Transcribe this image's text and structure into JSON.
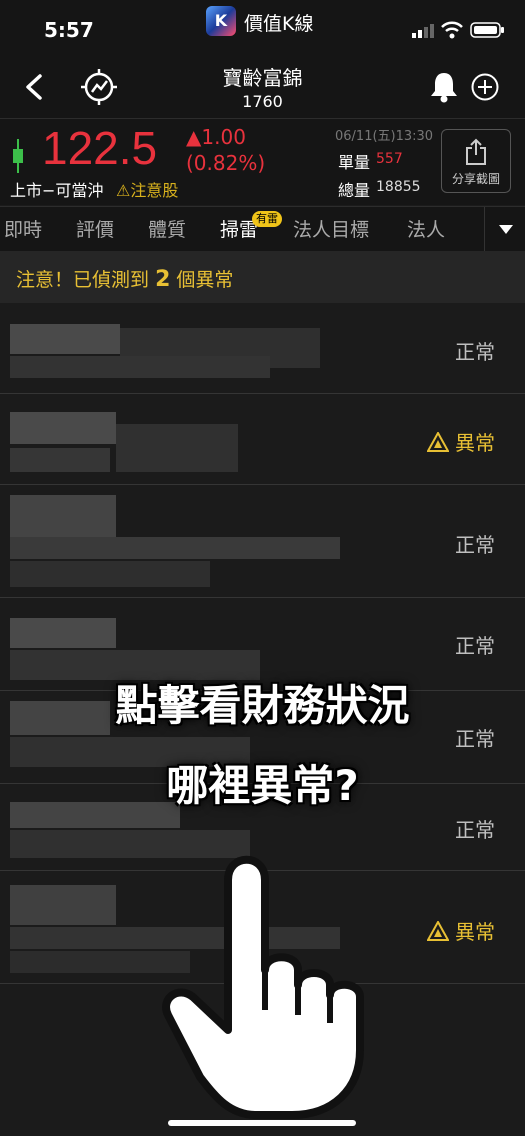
{
  "status_bar": {
    "time": "5:57",
    "app_name": "價值K線",
    "app_logo_letter": "K"
  },
  "header": {
    "stock_name": "寶齡富錦",
    "stock_code": "1760"
  },
  "price": {
    "value": "122.5",
    "change": "▲1.00",
    "change_pct": "(0.82%)",
    "market": "上市−可當沖",
    "warning": "⚠注意股",
    "datetime": "06/11(五)13:30",
    "unit_vol_label": "單量",
    "unit_vol": "557",
    "total_vol_label": "總量",
    "total_vol": "18855",
    "share_label": "分享截圖"
  },
  "tabs": [
    {
      "label": "即時"
    },
    {
      "label": "評價"
    },
    {
      "label": "體質"
    },
    {
      "label": "掃雷",
      "badge": "有雷",
      "active": true
    },
    {
      "label": "法人目標"
    },
    {
      "label": "法人"
    }
  ],
  "alert": {
    "prefix": "注意！已偵測到",
    "count": "2",
    "suffix": "個異常"
  },
  "rows": [
    {
      "status": "正常",
      "type": "normal"
    },
    {
      "status": "異常",
      "type": "abnormal"
    },
    {
      "status": "正常",
      "type": "normal"
    },
    {
      "status": "正常",
      "type": "normal"
    },
    {
      "status": "正常",
      "type": "normal"
    },
    {
      "status": "正常",
      "type": "normal"
    },
    {
      "status": "異常",
      "type": "abnormal"
    }
  ],
  "overlay": {
    "line1": "點擊看財務狀況",
    "line2": "哪裡異常?"
  },
  "colors": {
    "up": "#e8323d",
    "warning": "#e8c034",
    "background": "#1b1b1b"
  }
}
